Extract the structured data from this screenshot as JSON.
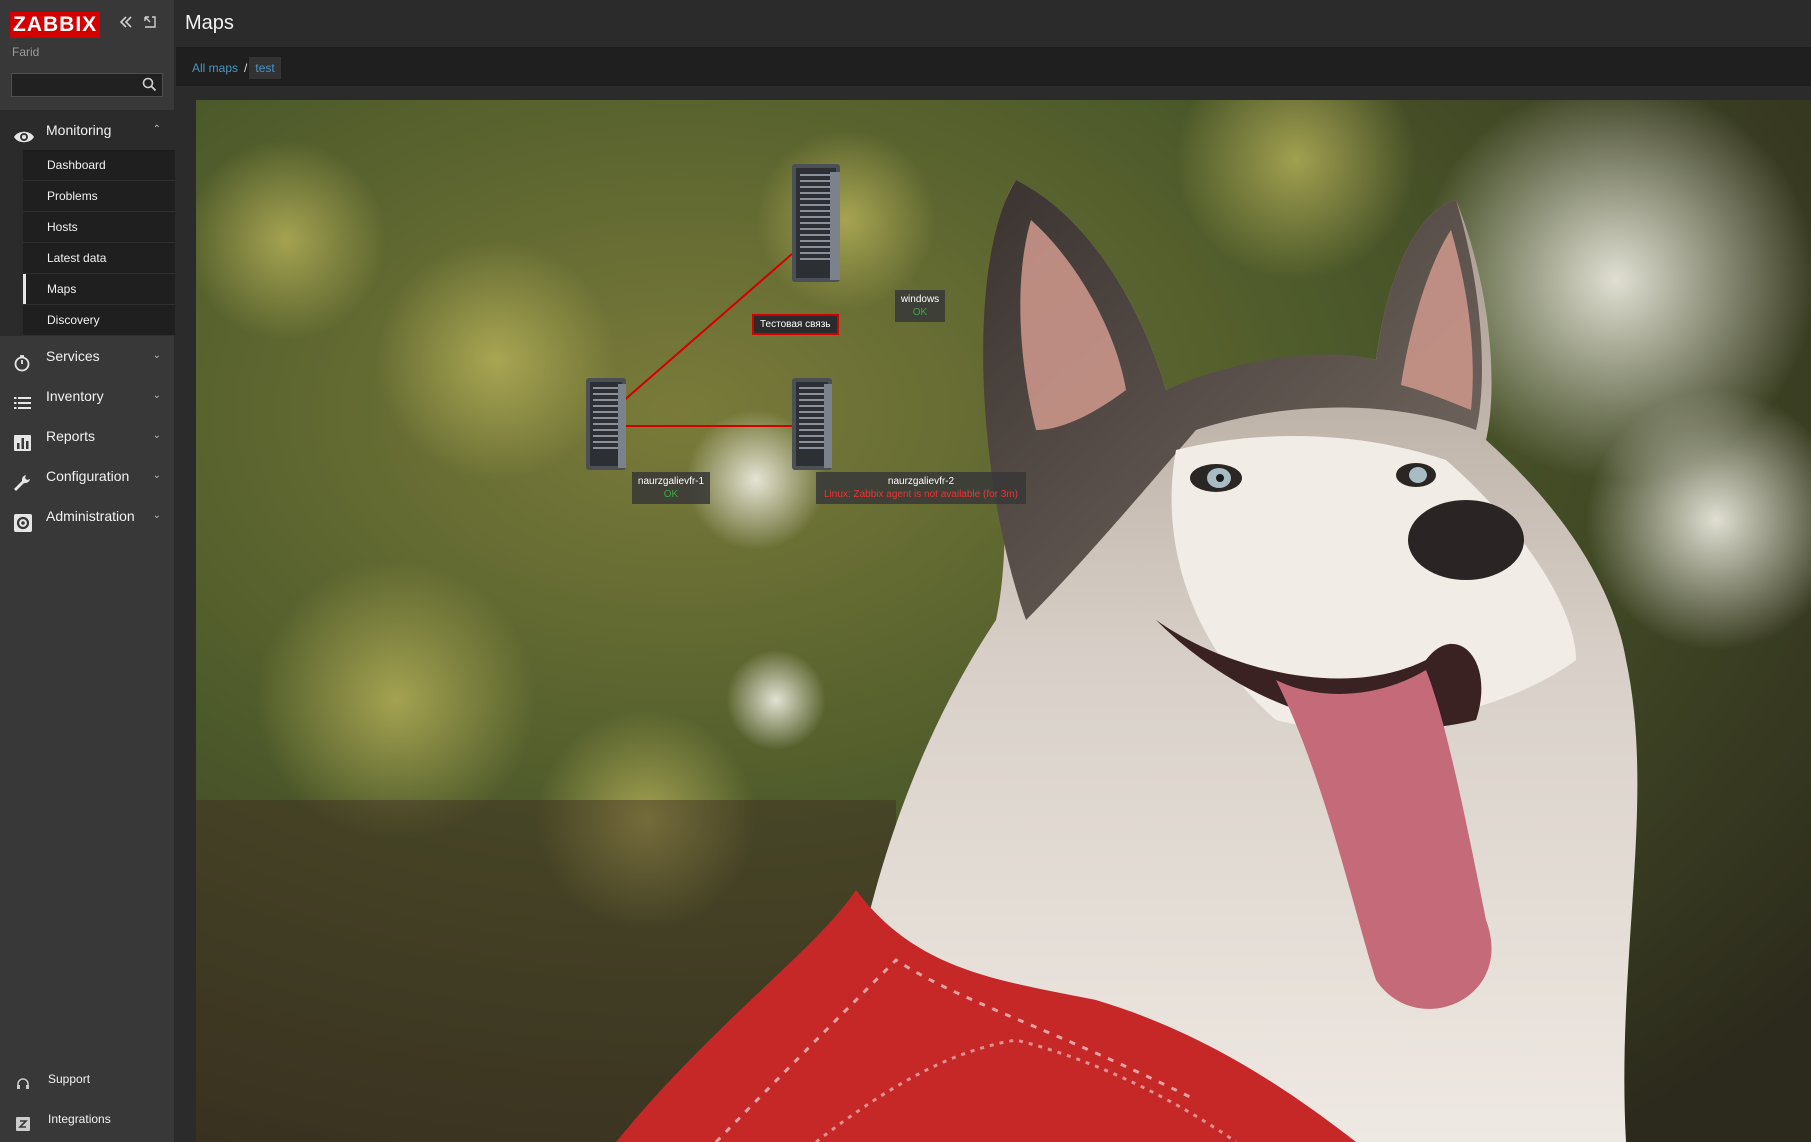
{
  "brand": {
    "name": "ZABBIX",
    "color": "#d40000"
  },
  "sidebar": {
    "user": "Farid",
    "search_placeholder": "",
    "collapse_icon": "double-chevron-left-icon",
    "kiosk_icon": "fullscreen-icon",
    "menu": [
      {
        "label": "Monitoring",
        "icon": "eye-icon",
        "open": true
      },
      {
        "label": "Services",
        "icon": "stopwatch-icon",
        "open": false
      },
      {
        "label": "Inventory",
        "icon": "list-icon",
        "open": false
      },
      {
        "label": "Reports",
        "icon": "bar-chart-icon",
        "open": false
      },
      {
        "label": "Configuration",
        "icon": "wrench-icon",
        "open": false
      },
      {
        "label": "Administration",
        "icon": "gear-icon",
        "open": false
      }
    ],
    "monitoring_items": [
      {
        "label": "Dashboard"
      },
      {
        "label": "Problems"
      },
      {
        "label": "Hosts"
      },
      {
        "label": "Latest data"
      },
      {
        "label": "Maps",
        "selected": true
      },
      {
        "label": "Discovery"
      }
    ],
    "support": "Support",
    "integrations": "Integrations"
  },
  "header": {
    "title": "Maps"
  },
  "breadcrumb": {
    "all_maps": "All maps",
    "separator": "/",
    "current": "test"
  },
  "map": {
    "link_label": "Тестовая связь",
    "link_color": "#d40000",
    "hosts": [
      {
        "name": "windows",
        "status": "OK",
        "status_color": "#3ba84a"
      },
      {
        "name": "naurzgalievfr-1",
        "status": "OK",
        "status_color": "#3ba84a"
      },
      {
        "name": "naurzgalievfr-2",
        "status": "Linux: Zabbix agent is not available (for 3m)",
        "status_color": "#e33333"
      }
    ]
  }
}
